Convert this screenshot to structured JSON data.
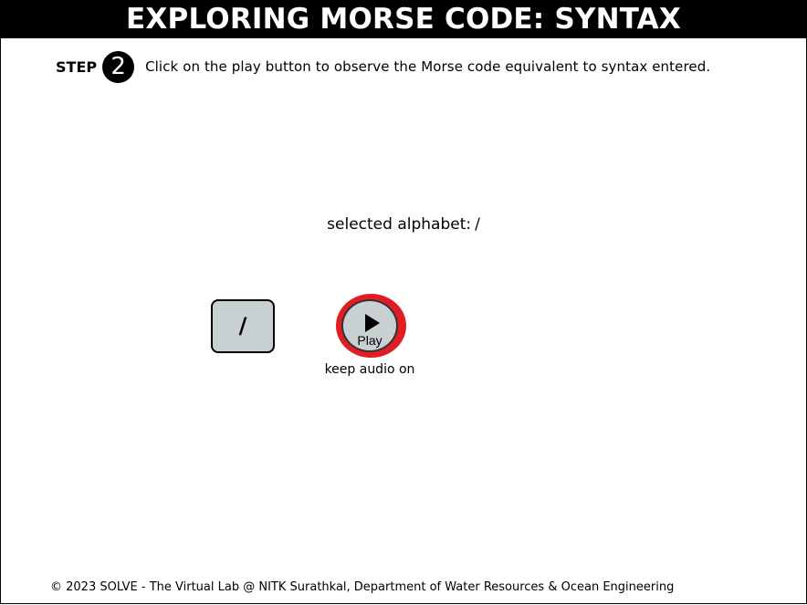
{
  "header": {
    "title": "EXPLORING MORSE CODE: SYNTAX"
  },
  "step": {
    "label": "STEP",
    "number": "2",
    "instruction": "Click on the play button to observe the Morse code equivalent to syntax entered."
  },
  "selection": {
    "label": "selected alphabet:",
    "value": "/"
  },
  "controls": {
    "char_key": "/",
    "play_label": "Play",
    "audio_note": "keep audio on",
    "play_highlight_color": "#e01c24",
    "key_color": "#c9d0d1"
  },
  "footer": {
    "text": "© 2023 SOLVE - The Virtual Lab @ NITK Surathkal, Department of Water Resources & Ocean Engineering"
  }
}
